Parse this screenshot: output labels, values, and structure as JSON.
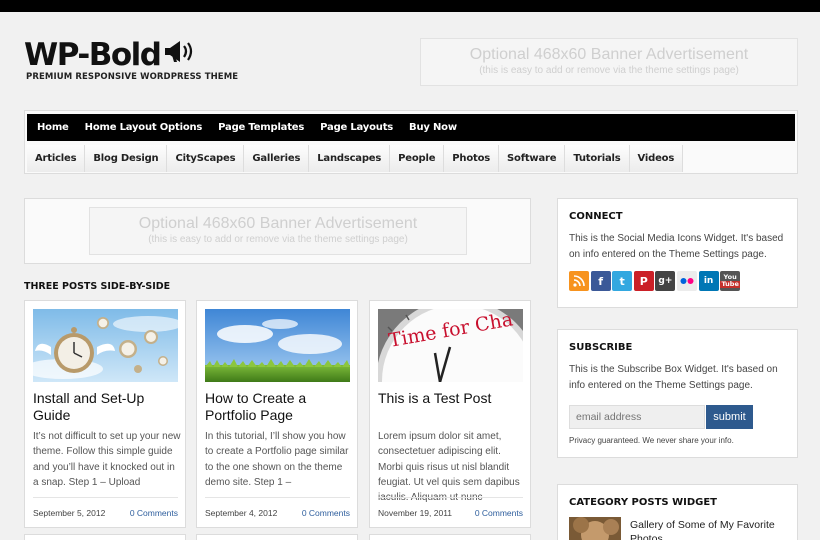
{
  "header": {
    "logo_text": "WP-Bold",
    "tagline": "PREMIUM RESPONSIVE WORDPRESS THEME",
    "banner_line1": "Optional 468x60 Banner Advertisement",
    "banner_line2": "(this is easy to add or remove via the theme settings page)"
  },
  "nav_primary": [
    {
      "label": "Home"
    },
    {
      "label": "Home Layout Options"
    },
    {
      "label": "Page Templates"
    },
    {
      "label": "Page Layouts"
    },
    {
      "label": "Buy Now"
    }
  ],
  "nav_secondary": [
    {
      "label": "Articles"
    },
    {
      "label": "Blog Design"
    },
    {
      "label": "CityScapes"
    },
    {
      "label": "Galleries"
    },
    {
      "label": "Landscapes"
    },
    {
      "label": "People"
    },
    {
      "label": "Photos"
    },
    {
      "label": "Software"
    },
    {
      "label": "Tutorials"
    },
    {
      "label": "Videos"
    }
  ],
  "main_banner": {
    "line1": "Optional 468x60 Banner Advertisement",
    "line2": "(this is easy to add or remove via the theme settings page)"
  },
  "section_title": "THREE POSTS SIDE-BY-SIDE",
  "posts": [
    {
      "title": "Install and Set-Up Guide",
      "excerpt": "It’s not difficult to set up your new theme. Follow this simple guide and you’ll have it knocked out in a snap. Step 1 – Upload",
      "date": "September 5, 2012",
      "comments": "0 Comments",
      "thumb_icon": "flying-pocket-watches-image"
    },
    {
      "title": "How to Create a Portfolio Page",
      "excerpt": "In this tutorial, I’ll show you how to create a Portfolio page similar to the one shown on the theme demo site. Step 1 –",
      "date": "September 4, 2012",
      "comments": "0 Comments",
      "thumb_icon": "grass-and-sky-image"
    },
    {
      "title": "This is a Test Post",
      "excerpt": "Lorem ipsum dolor sit amet, consectetuer adipiscing elit. Morbi quis risus ut nisl blandit feugiat. Ut vel quis sem dapibus iaculis. Aliquam ut nunc",
      "date": "November 19, 2011",
      "comments": "0 Comments",
      "thumb_icon": "time-for-change-clock-image",
      "thumb_text": "Time for Cha"
    }
  ],
  "sidebar": {
    "connect": {
      "title": "CONNECT",
      "text": "This is the Social Media Icons Widget. It's based on info entered on the Theme Settings page.",
      "icons": [
        {
          "name": "rss-icon",
          "glyph": ")",
          "color": "#f7931e"
        },
        {
          "name": "facebook-icon",
          "glyph": "f",
          "color": "#3b5998"
        },
        {
          "name": "twitter-icon",
          "glyph": "t",
          "color": "#33a8e0"
        },
        {
          "name": "pinterest-icon",
          "glyph": "P",
          "color": "#cb2027"
        },
        {
          "name": "google-plus-icon",
          "glyph": "g+",
          "color": "#444444"
        },
        {
          "name": "flickr-icon",
          "glyph": "••",
          "color": "#e8e8e8"
        },
        {
          "name": "linkedin-icon",
          "glyph": "in",
          "color": "#0077b5"
        },
        {
          "name": "youtube-icon",
          "glyph": "You",
          "color": "#555555"
        }
      ]
    },
    "subscribe": {
      "title": "SUBSCRIBE",
      "text": "This is the Subscribe Box Widget. It's based on info entered on the Theme Settings page.",
      "placeholder": "email address",
      "button": "submit",
      "privacy": "Privacy guaranteed. We never share your info."
    },
    "category": {
      "title": "CATEGORY POSTS WIDGET",
      "item_title": "Gallery of Some of My Favorite Photos"
    }
  }
}
